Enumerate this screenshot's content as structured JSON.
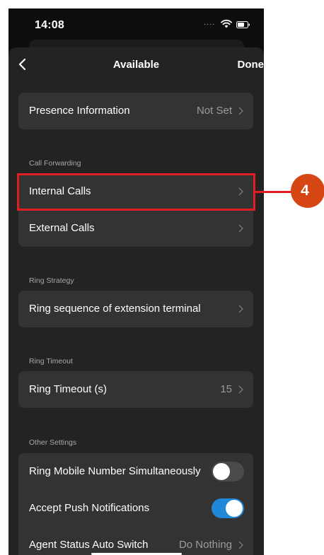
{
  "status_bar": {
    "time": "14:08",
    "signal": "....",
    "icons": [
      "wifi-icon",
      "battery-icon"
    ]
  },
  "nav": {
    "title": "Available",
    "back_icon": "chevron-left-icon",
    "done_label": "Done"
  },
  "presence": {
    "label": "Presence Information",
    "value": "Not Set"
  },
  "call_forwarding": {
    "header": "Call Forwarding",
    "internal_label": "Internal Calls",
    "external_label": "External Calls"
  },
  "ring_strategy": {
    "header": "Ring Strategy",
    "label": "Ring sequence of extension terminal"
  },
  "ring_timeout": {
    "header": "Ring Timeout",
    "label": "Ring Timeout (s)",
    "value": "15"
  },
  "other_settings": {
    "header": "Other Settings",
    "ring_mobile_label": "Ring Mobile Number Simultaneously",
    "ring_mobile_enabled": false,
    "push_label": "Accept Push Notifications",
    "push_enabled": true,
    "agent_status_label": "Agent Status Auto Switch",
    "agent_status_value": "Do Nothing"
  },
  "annotation": {
    "step_number": "4",
    "color": "#e11d23",
    "badge_color": "#d64615"
  },
  "colors": {
    "background": "#0d0d0d",
    "sheet": "#232323",
    "row": "#333333",
    "toggle_on": "#1f88d9"
  }
}
